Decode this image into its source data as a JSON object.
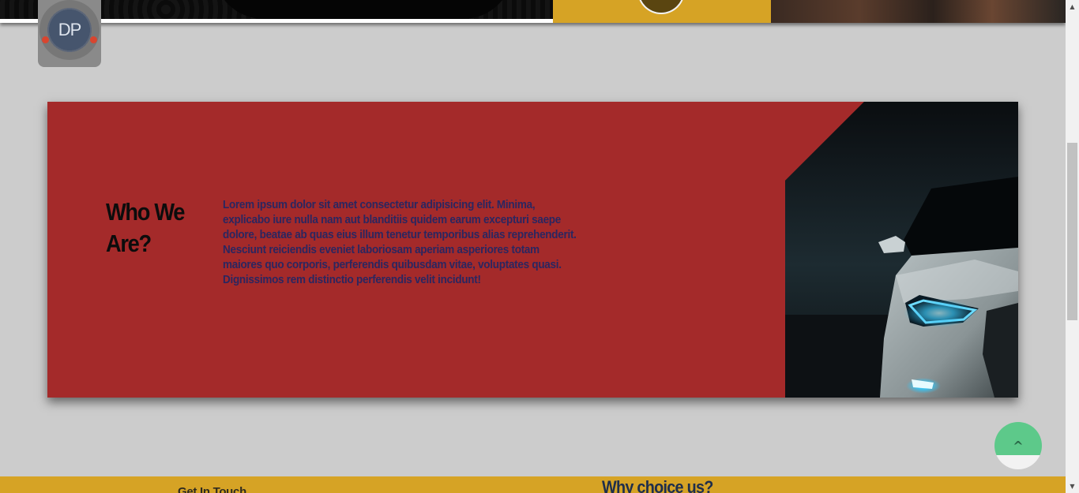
{
  "logo": {
    "initials": "DP"
  },
  "about": {
    "title": "Who We Are?",
    "text": "Lorem ipsum dolor sit amet consectetur adipisicing elit. Minima, explicabo iure nulla nam aut blanditiis quidem earum excepturi saepe dolore, beatae ab quas eius illum tenetur temporibus alias reprehenderit. Nesciunt reiciendis eveniet laboriosam aperiam asperiores totam maiores quo corporis, perferendis quibusdam vitae, voluptates quasi. Dignissimos rem distinctio perferendis velit incidunt!"
  },
  "scroll_top": {
    "label": "^"
  },
  "footer": {
    "left_title": "Get In Touch",
    "right_title": "Why choice us?"
  },
  "colors": {
    "page_bg": "#cccccc",
    "card_red": "#a42a2a",
    "gold": "#d6a325",
    "text_navy": "#2b2660",
    "scroll_button_green": "#5dc98a"
  },
  "icons": {
    "scroll_top": "caret-up-icon",
    "scroll_up": "triangle-up-icon",
    "scroll_down": "triangle-down-icon"
  }
}
